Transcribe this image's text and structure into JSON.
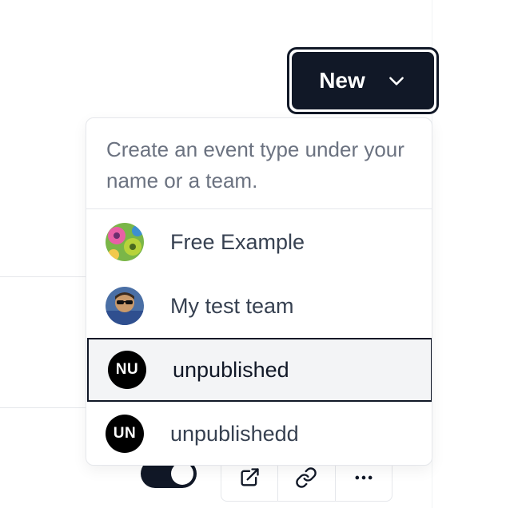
{
  "new_button": {
    "label": "New",
    "icon": "chevron-down-icon"
  },
  "dropdown": {
    "description": "Create an event type under your name or a team.",
    "items": [
      {
        "label": "Free Example",
        "avatar": "flower-photo"
      },
      {
        "label": "My test team",
        "avatar": "person-photo"
      },
      {
        "label": "unpublished",
        "avatar_initials": "NU",
        "active": true
      },
      {
        "label": "unpublishedd",
        "avatar_initials": "UN"
      }
    ]
  },
  "toolbar": {
    "toggle_on": true,
    "buttons": [
      "external-link-icon",
      "link-icon",
      "more-horizontal-icon"
    ]
  },
  "colors": {
    "primary": "#111827",
    "border": "#e5e7eb",
    "muted_text": "#6b7280",
    "active_bg": "#f3f4f6"
  }
}
